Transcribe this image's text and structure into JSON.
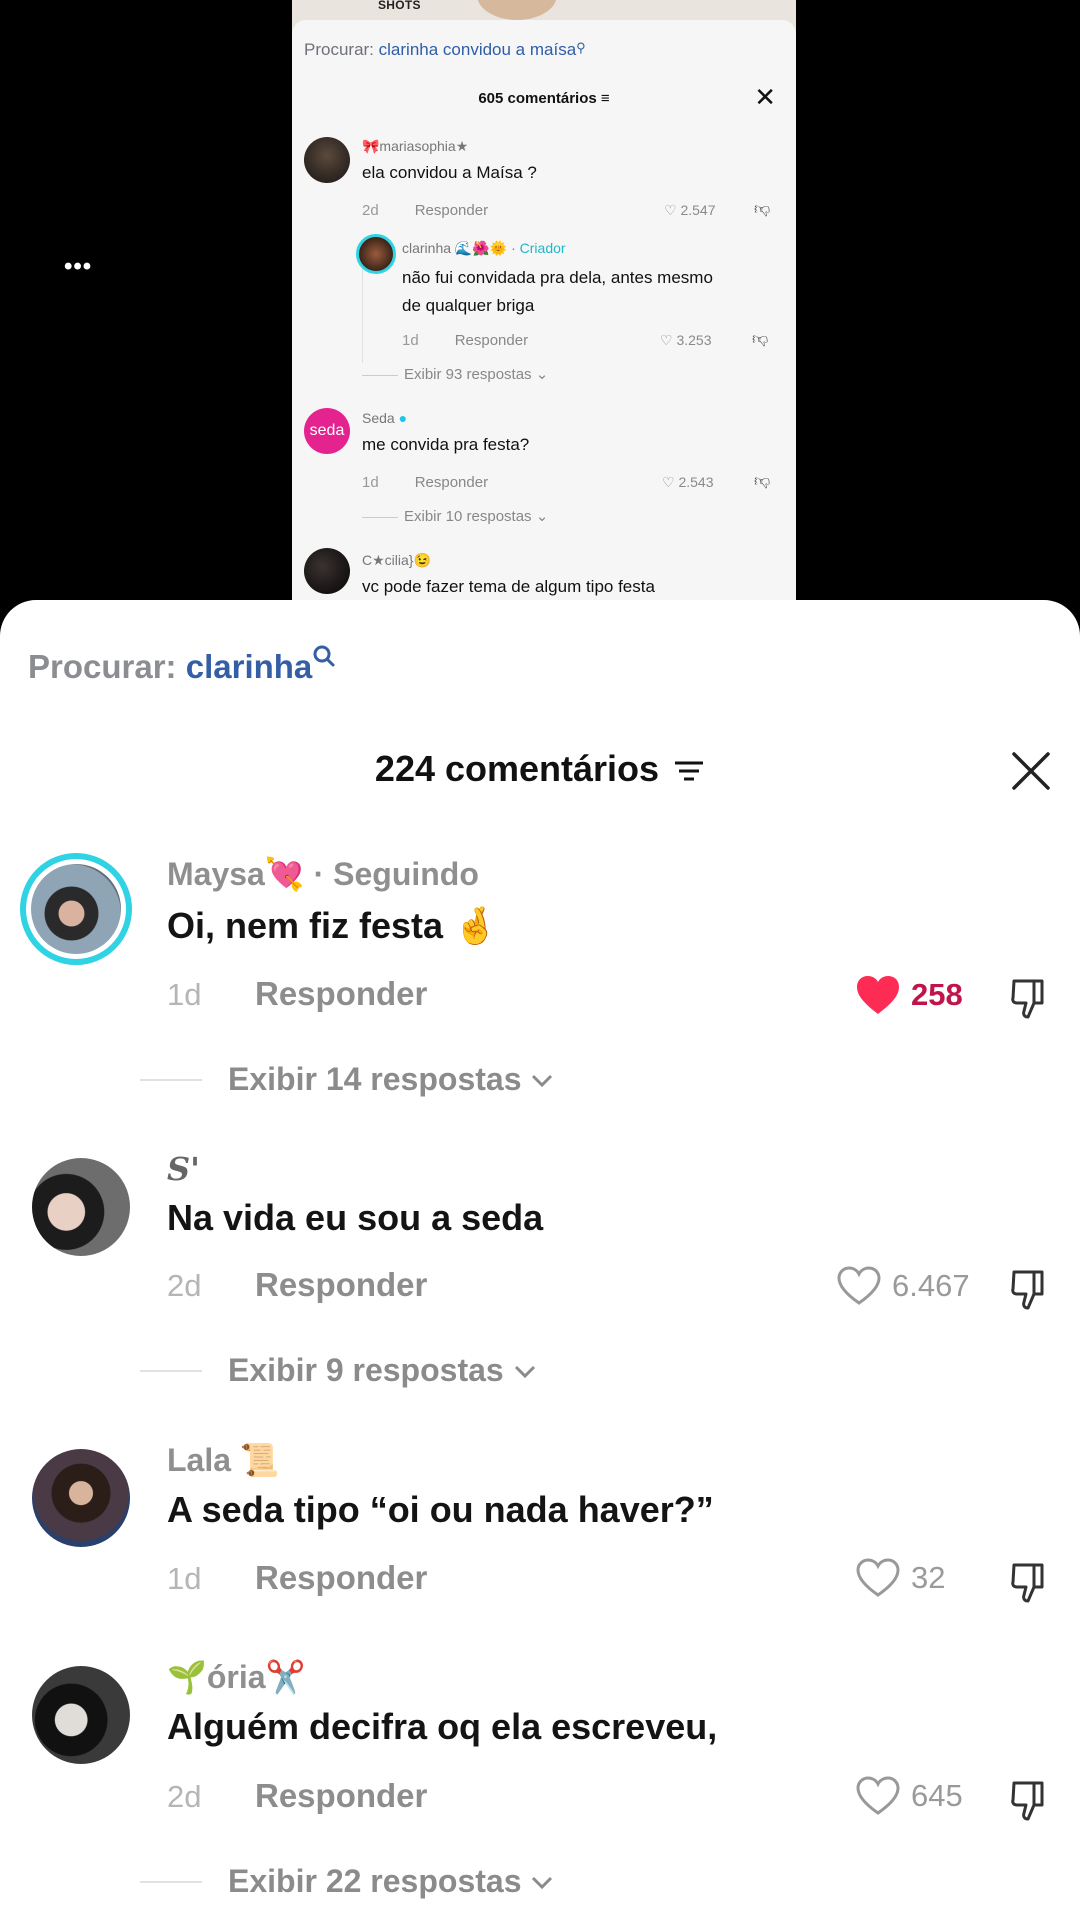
{
  "top_video": {
    "overlay_text": "SHOTS",
    "search": {
      "label": "Procurar:",
      "query": "clarinha convidou a maísa"
    },
    "title": "605 comentários",
    "comments": [
      {
        "name": "🎀mariasophia★",
        "text": "ela convidou a Maísa ?",
        "time": "2d",
        "reply": "Responder",
        "likes": "2.547",
        "more": ""
      },
      {
        "name": "clarinha 🌊🌺🌞 · ",
        "badge": "Criador",
        "text1": "não fui convidada pra dela, antes mesmo",
        "text2": "de qualquer briga",
        "time": "1d",
        "reply": "Responder",
        "likes": "3.253",
        "more": "Exibir 93 respostas"
      },
      {
        "name": "Seda",
        "avatar_text": "seda",
        "text": "me convida pra festa?",
        "time": "1d",
        "reply": "Responder",
        "likes": "2.543",
        "more": "Exibir 10 respostas"
      },
      {
        "name": "C★cilia}😉",
        "text": "vc pode fazer tema de algum tipo festa"
      }
    ]
  },
  "more_menu": "•••",
  "search": {
    "label": "Procurar:",
    "query": "clarinha"
  },
  "header": {
    "title": "224 comentários"
  },
  "comments": [
    {
      "name": "Maysa💘 · Seguindo",
      "text": "Oi, nem fiz festa 🤞",
      "time": "1d",
      "reply": "Responder",
      "likes": "258",
      "liked": true,
      "more": "Exibir 14 respostas"
    },
    {
      "name": "S'",
      "text": "Na vida eu sou a seda",
      "time": "2d",
      "reply": "Responder",
      "likes": "6.467",
      "liked": false,
      "more": "Exibir 9 respostas"
    },
    {
      "name": "Lala 📜",
      "text": "A seda tipo “oi ou nada haver?”",
      "time": "1d",
      "reply": "Responder",
      "likes": "32",
      "liked": false,
      "more": ""
    },
    {
      "name": "🌱ória✂️",
      "text": "Alguém decifra oq ela escreveu,",
      "time": "2d",
      "reply": "Responder",
      "likes": "645",
      "liked": false,
      "more": "Exibir 22 respostas"
    }
  ],
  "colors": {
    "like_active": "#fe2c55",
    "search_query": "#345fa5",
    "creator_badge": "#21b7c8",
    "story_ring": "#2fd3e3"
  }
}
